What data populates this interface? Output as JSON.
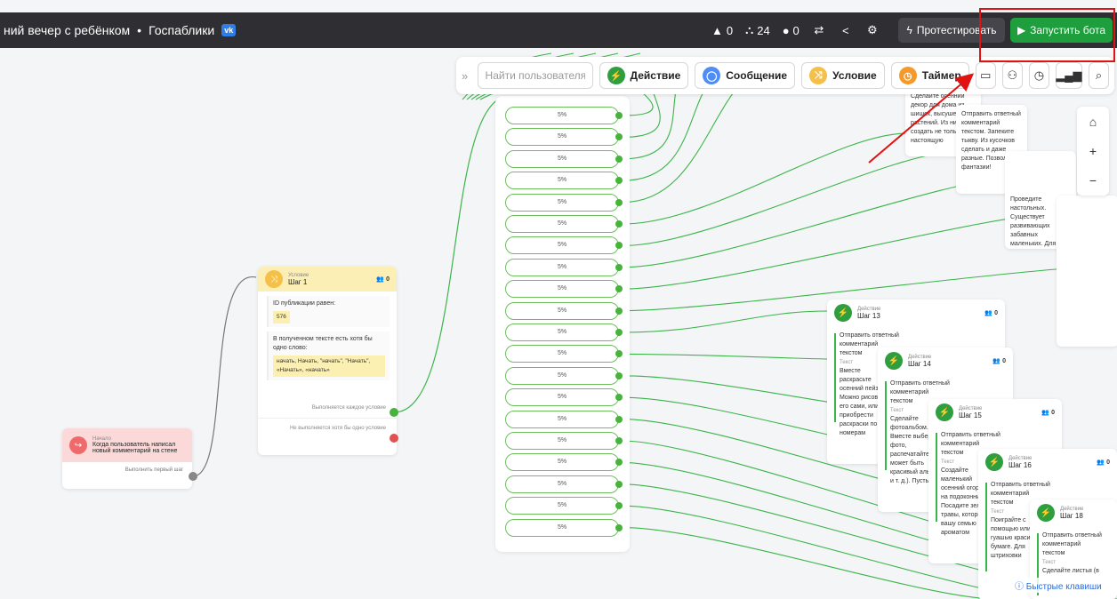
{
  "topbar": {
    "breadcrumb": "ний вечер с ребёнком",
    "separator": "•",
    "community": "Госпаблики",
    "vk_badge": "vk",
    "stats": [
      {
        "icon": "warning-icon",
        "value": "0"
      },
      {
        "icon": "sitemap-icon",
        "value": "24"
      },
      {
        "icon": "user-icon",
        "value": "0"
      }
    ],
    "test_button": "Протестировать",
    "run_button": "Запустить бота"
  },
  "toolbar": {
    "search_placeholder": "Найти пользователя",
    "chips": [
      {
        "label": "Действие",
        "icon": "lightning-icon",
        "color": "#2e9e3f"
      },
      {
        "label": "Сообщение",
        "icon": "message-icon",
        "color": "#4d8df5"
      },
      {
        "label": "Условие",
        "icon": "condition-icon",
        "color": "#f5c04a"
      },
      {
        "label": "Таймер",
        "icon": "timer-icon",
        "color": "#f59a2a"
      }
    ]
  },
  "start_node": {
    "type": "Начало",
    "text": "Когда пользователь написал новый комментарий на стене",
    "footer": "Выполнить первый шаг"
  },
  "condition_node": {
    "type": "Условие",
    "title": "Шаг 1",
    "count": "0",
    "cond1_label": "ID публикации равен:",
    "cond1_value": "576",
    "cond2_label": "В полученном тексте есть хотя бы одно слово:",
    "cond2_value": "начать, Начать, \"начать\", \"Начать\", «Начать», «начать»",
    "yes": "Выполняется каждое условие",
    "no": "Не выполняется хотя бы одно условие"
  },
  "split": {
    "percent": [
      "5%",
      "5%",
      "5%",
      "5%",
      "5%",
      "5%",
      "5%",
      "5%",
      "5%",
      "5%",
      "5%",
      "5%",
      "5%",
      "5%",
      "5%",
      "5%",
      "5%",
      "5%",
      "5%",
      "5%"
    ]
  },
  "actions": [
    {
      "type": "Действие",
      "title": "Шаг 13",
      "count": "0",
      "line1": "Отправить ответный",
      "line2": "комментарий",
      "line3": "текстом",
      "sub": "Текст",
      "body": "Вместе раскрасьте осенний пейзаж. Можно рисовать его сами, или приобрести раскраски по номерам"
    },
    {
      "type": "Действие",
      "title": "Шаг 14",
      "count": "0",
      "line1": "Отправить ответный",
      "line2": "комментарий",
      "line3": "текстом",
      "sub": "Текст",
      "body": "Сделайте фотоальбом. Вместе выберите фото, распечатайте их, может быть красивый альбом и т. д.). Пусть"
    },
    {
      "type": "Действие",
      "title": "Шаг 15",
      "count": "0",
      "line1": "Отправить ответный",
      "line2": "комментарий",
      "line3": "текстом",
      "sub": "Текст",
      "body": "Создайте маленький осенний огород на подоконнике. Посадите зелень, травы, которые вашу семью ароматом"
    },
    {
      "type": "Действие",
      "title": "Шаг 16",
      "count": "0",
      "line1": "Отправить ответный",
      "line2": "комментарий",
      "line3": "текстом",
      "sub": "Текст",
      "body": "Поиграйте с помощью или гуашью красивые бумаге. Для штриховки"
    },
    {
      "type": "Действие",
      "title": "Шаг 18",
      "count": "",
      "line1": "Отправить ответный",
      "line2": "комментарий",
      "line3": "текстом",
      "sub": "Текст",
      "body": "Сделайте листья (в"
    }
  ],
  "top_cards": [
    {
      "text": "Сделайте осенний декор для дома из шишек, высушенных растений. Из них создать не только настоящую"
    },
    {
      "text": "Отправить ответный комментарий текстом. Запеките тыкву. Из кусочков сделать и даже разные. Позвольте фантазии!"
    },
    {
      "text": "Проведите настольных. Существует развивающих забавных маленьких. Для малыш"
    }
  ],
  "hotkeys": "Быстрые клавиши",
  "colors": {
    "green": "#3bb54a",
    "accent_red": "#e11212",
    "topbar": "#2f2f33"
  }
}
